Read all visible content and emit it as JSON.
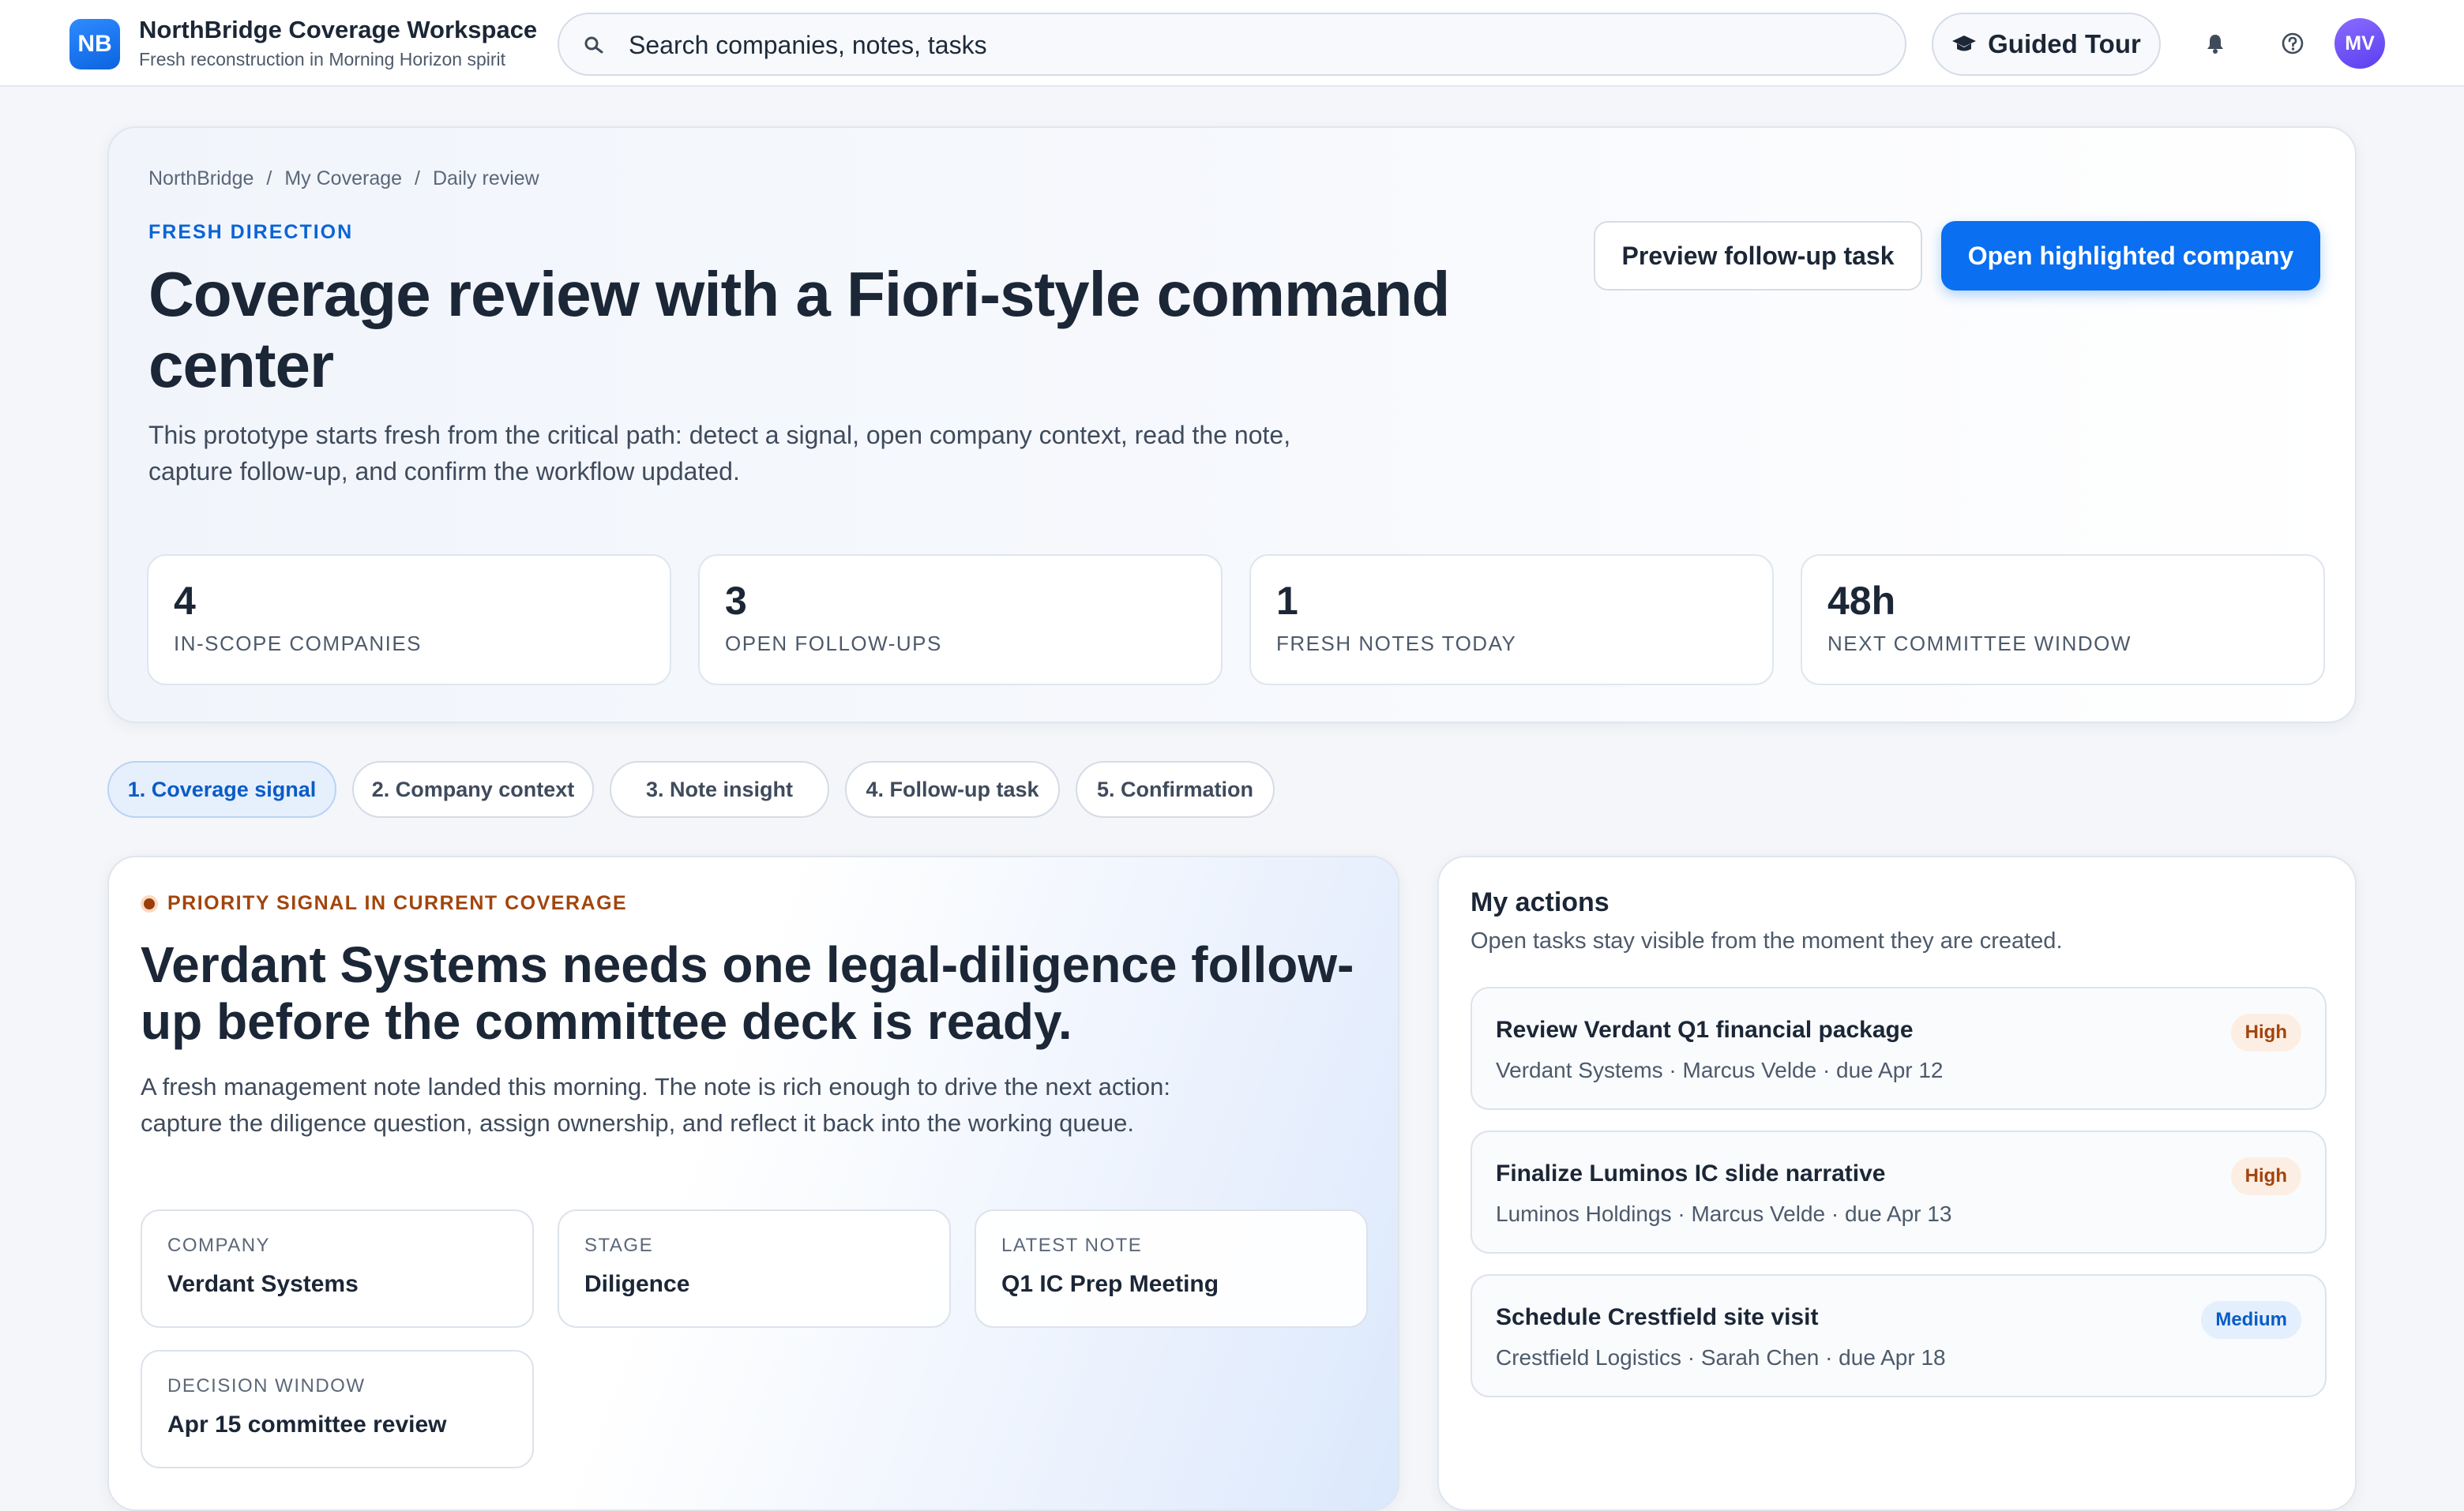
{
  "app": {
    "logo": "NB",
    "title": "NorthBridge Coverage Workspace",
    "subtitle": "Fresh reconstruction in Morning Horizon spirit"
  },
  "search": {
    "placeholder": "Search companies, notes, tasks",
    "icon": "search-icon"
  },
  "toolbar": {
    "tour_label": "Guided Tour",
    "tour_icon": "graduation-cap-icon",
    "notifications_icon": "bell-icon",
    "help_icon": "help-circle-icon",
    "avatar_initials": "MV"
  },
  "breadcrumb": [
    "NorthBridge",
    "My Coverage",
    "Daily review"
  ],
  "breadcrumb_separator": "/",
  "hero": {
    "eyebrow": "FRESH DIRECTION",
    "title": "Coverage review with a Fiori-style command center",
    "description": "This prototype starts fresh from the critical path: detect a signal, open company context, read the note, capture follow-up, and confirm the workflow updated.",
    "secondary_button": "Preview follow-up task",
    "primary_button": "Open highlighted company"
  },
  "stats": [
    {
      "value": "4",
      "label": "IN-SCOPE COMPANIES"
    },
    {
      "value": "3",
      "label": "OPEN FOLLOW-UPS"
    },
    {
      "value": "1",
      "label": "FRESH NOTES TODAY"
    },
    {
      "value": "48h",
      "label": "NEXT COMMITTEE WINDOW"
    }
  ],
  "steps": [
    {
      "label": "1. Coverage signal",
      "active": true
    },
    {
      "label": "2. Company context",
      "active": false
    },
    {
      "label": "3. Note insight",
      "active": false
    },
    {
      "label": "4. Follow-up task",
      "active": false
    },
    {
      "label": "5. Confirmation",
      "active": false
    }
  ],
  "signal": {
    "eyebrow": "PRIORITY SIGNAL IN CURRENT COVERAGE",
    "title": "Verdant Systems needs one legal-diligence follow-up before the committee deck is ready.",
    "description": "A fresh management note landed this morning. The note is rich enough to drive the next action: capture the diligence question, assign ownership, and reflect it back into the working queue.",
    "fields": [
      {
        "label": "COMPANY",
        "value": "Verdant Systems"
      },
      {
        "label": "STAGE",
        "value": "Diligence"
      },
      {
        "label": "LATEST NOTE",
        "value": "Q1 IC Prep Meeting"
      },
      {
        "label": "DECISION WINDOW",
        "value": "Apr 15 committee review"
      }
    ]
  },
  "actions": {
    "title": "My actions",
    "subtitle": "Open tasks stay visible from the moment they are created.",
    "tasks": [
      {
        "title": "Review Verdant Q1 financial package",
        "meta": "Verdant Systems · Marcus Velde · due Apr 12",
        "priority": "High"
      },
      {
        "title": "Finalize Luminos IC slide narrative",
        "meta": "Luminos Holdings · Marcus Velde · due Apr 13",
        "priority": "High"
      },
      {
        "title": "Schedule Crestfield site visit",
        "meta": "Crestfield Logistics · Sarah Chen · due Apr 18",
        "priority": "Medium"
      }
    ]
  },
  "colors": {
    "accent": "#0a6ff0",
    "priority_high": "#a2450d",
    "priority_medium": "#0a5cc7",
    "signal_dot": "#9a3d0a"
  }
}
